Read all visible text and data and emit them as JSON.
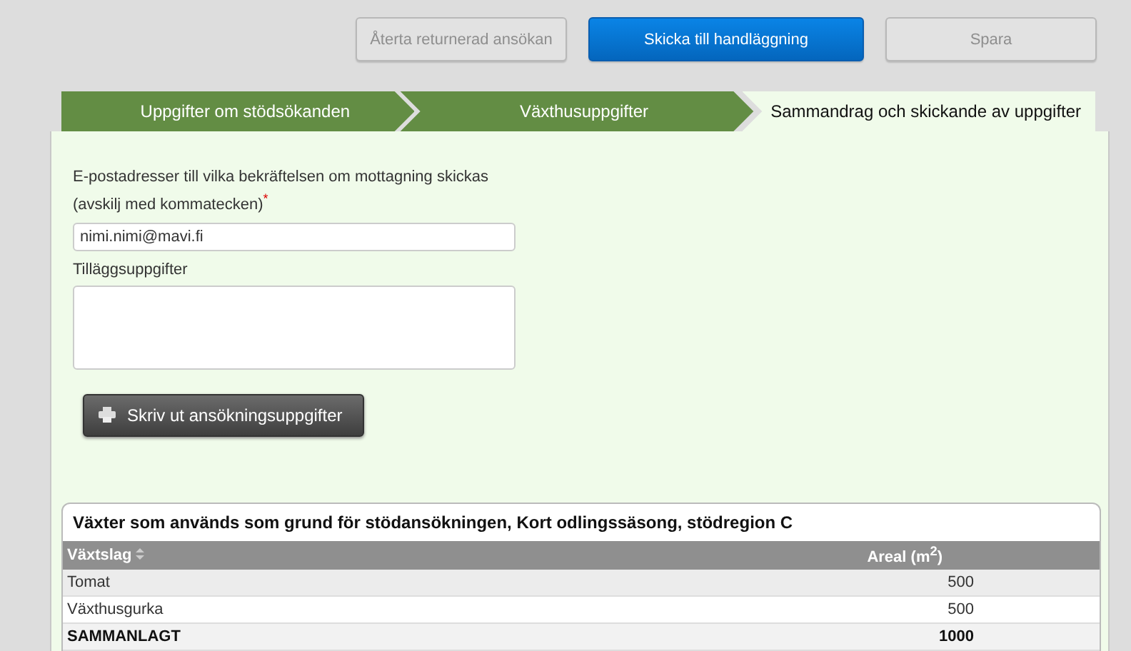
{
  "actions": [
    {
      "label": "Återta returnerad ansökan",
      "disabled": true,
      "primary": false
    },
    {
      "label": "Skicka till handläggning",
      "disabled": false,
      "primary": true
    },
    {
      "label": "Spara",
      "disabled": true,
      "primary": false
    }
  ],
  "tabs": [
    {
      "label": "Uppgifter om stödsökanden",
      "selected": false
    },
    {
      "label": "Växthusuppgifter",
      "selected": false
    },
    {
      "label": "Sammandrag och skickande av uppgifter",
      "selected": true
    }
  ],
  "form": {
    "email_label": "E-postadresser till vilka bekräftelsen om mottagning skickas (avskilj med kommatecken)",
    "email_required_mark": "*",
    "email_value": "nimi.nimi@mavi.fi",
    "extra_label": "Tilläggsuppgifter",
    "print_button": "Skriv ut ansökningsuppgifter"
  },
  "table": {
    "title": "Växter som används som grund för stödansökningen, Kort odlingssäsong, stödregion C",
    "columns": [
      {
        "label": "Växtslag",
        "sortable": true
      },
      {
        "label": "Areal (m$^{2}$)",
        "sortable": false
      }
    ],
    "rows": [
      {
        "kind": "item",
        "cells": [
          "Tomat",
          "500"
        ]
      },
      {
        "kind": "item",
        "cells": [
          "Växthusgurka",
          "500"
        ]
      },
      {
        "kind": "total",
        "cells": [
          "SAMMANLAGT",
          "1000"
        ]
      }
    ]
  }
}
